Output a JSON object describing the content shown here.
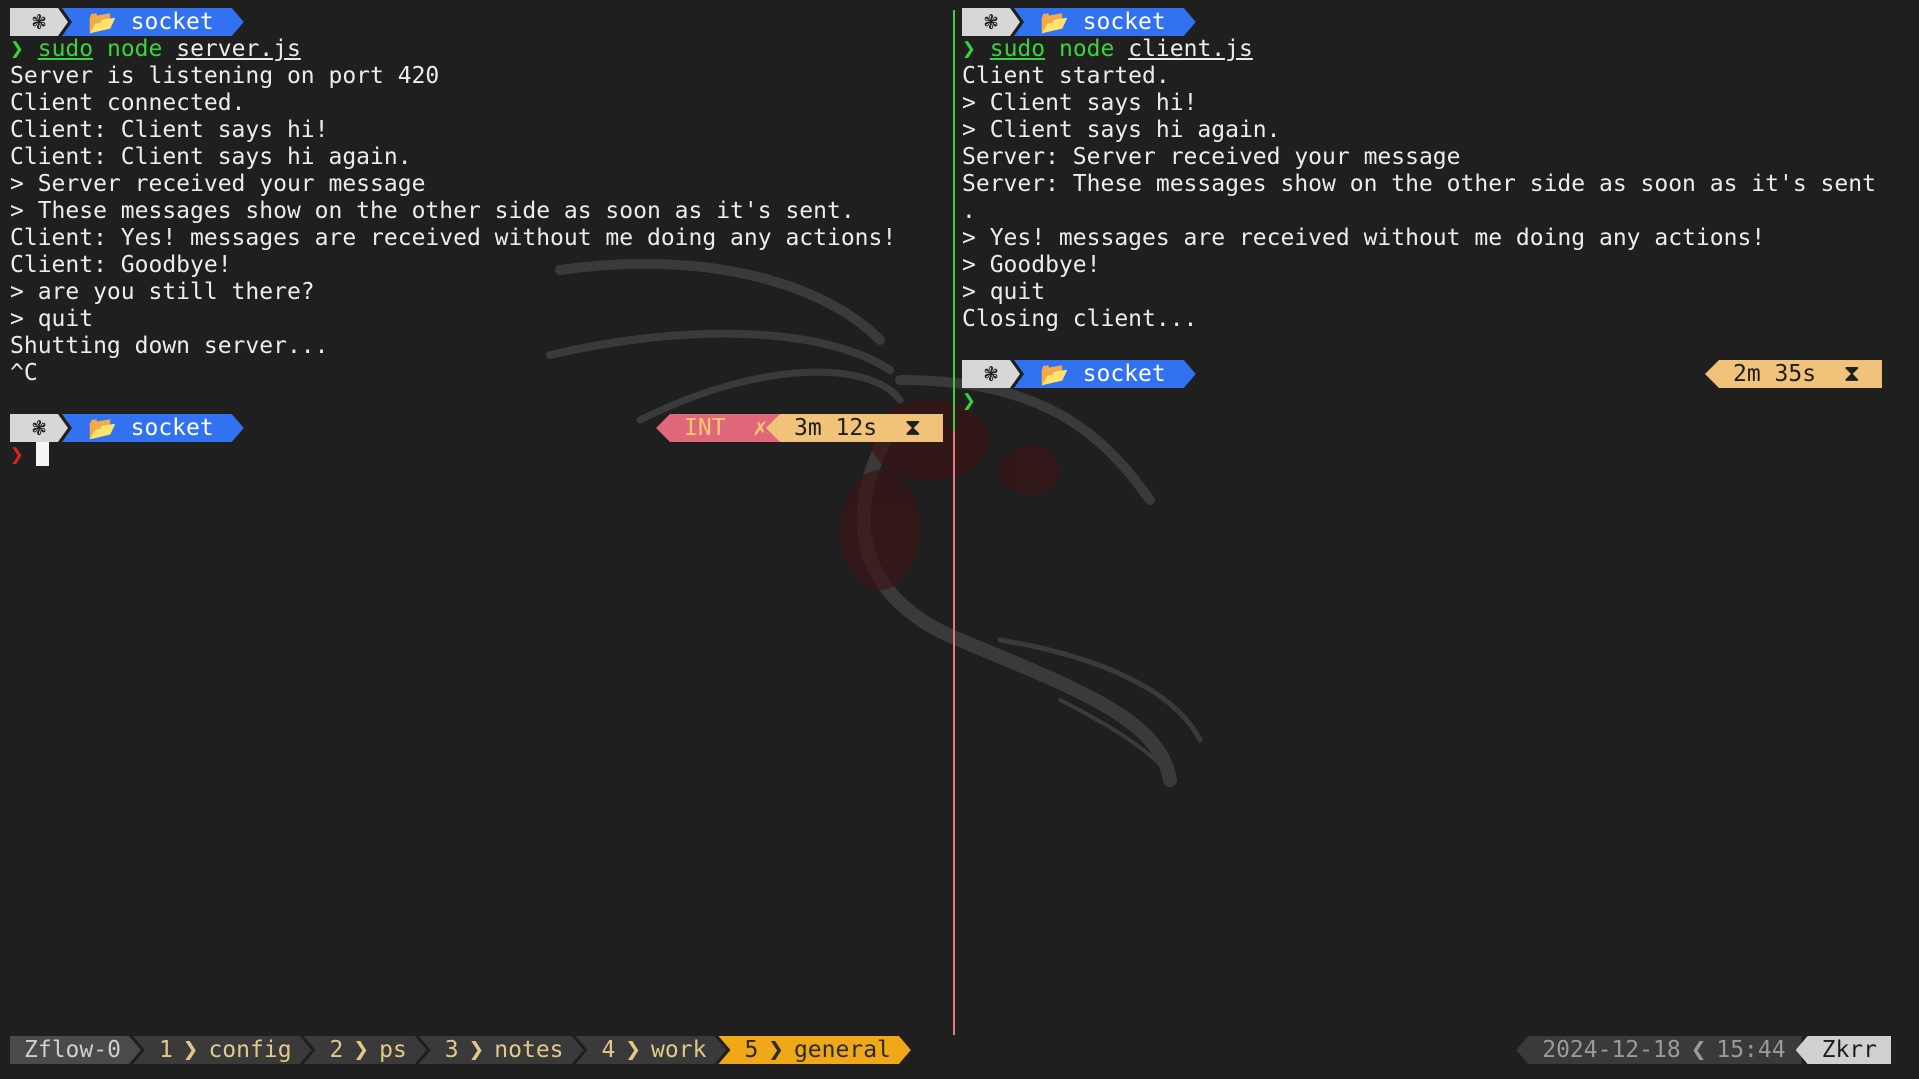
{
  "prompt": {
    "os_icon": "❃",
    "folder_icon": "📂",
    "dir": "socket"
  },
  "left": {
    "command": {
      "chevron": "❯",
      "sudo": "sudo",
      "cmd": "node",
      "file": "server.js"
    },
    "output": [
      "Server is listening on port 420",
      "Client connected.",
      "Client: Client says hi!",
      "Client: Client says hi again.",
      "> Server received your message",
      "> These messages show on the other side as soon as it's sent.",
      "Client: Yes! messages are received without me doing any actions!",
      "Client: Goodbye!",
      "> are you still there?",
      "> quit",
      "Shutting down server...",
      "^C"
    ],
    "status_int": "INT",
    "status_x": "✗",
    "duration": "3m 12s",
    "hourglass": "⧗",
    "prompt_chevron": "❯"
  },
  "right": {
    "command": {
      "chevron": "❯",
      "sudo": "sudo",
      "cmd": "node",
      "file": "client.js"
    },
    "output": [
      "Client started.",
      "> Client says hi!",
      "> Client says hi again.",
      "Server: Server received your message",
      "Server: These messages show on the other side as soon as it's sent",
      ".",
      "> Yes! messages are received without me doing any actions!",
      "> Goodbye!",
      "> quit",
      "Closing client..."
    ],
    "duration": "2m 35s",
    "hourglass": "⧗",
    "prompt_chevron": "❯"
  },
  "statusbar": {
    "session": "Zflow-0",
    "sep": "❯",
    "windows": [
      {
        "num": "1",
        "name": "config"
      },
      {
        "num": "2",
        "name": "ps"
      },
      {
        "num": "3",
        "name": "notes"
      },
      {
        "num": "4",
        "name": "work"
      },
      {
        "num": "5",
        "name": "general"
      }
    ],
    "date": "2024-12-18",
    "sep_left": "❮",
    "time": "15:44",
    "user": "Zkrr"
  },
  "colors": {
    "folder_blue": "#3272f0",
    "accent_orange": "#f0a818",
    "error_pink": "#e0677a",
    "time_tan": "#f1c27a",
    "prompt_green": "#3bd33b"
  }
}
